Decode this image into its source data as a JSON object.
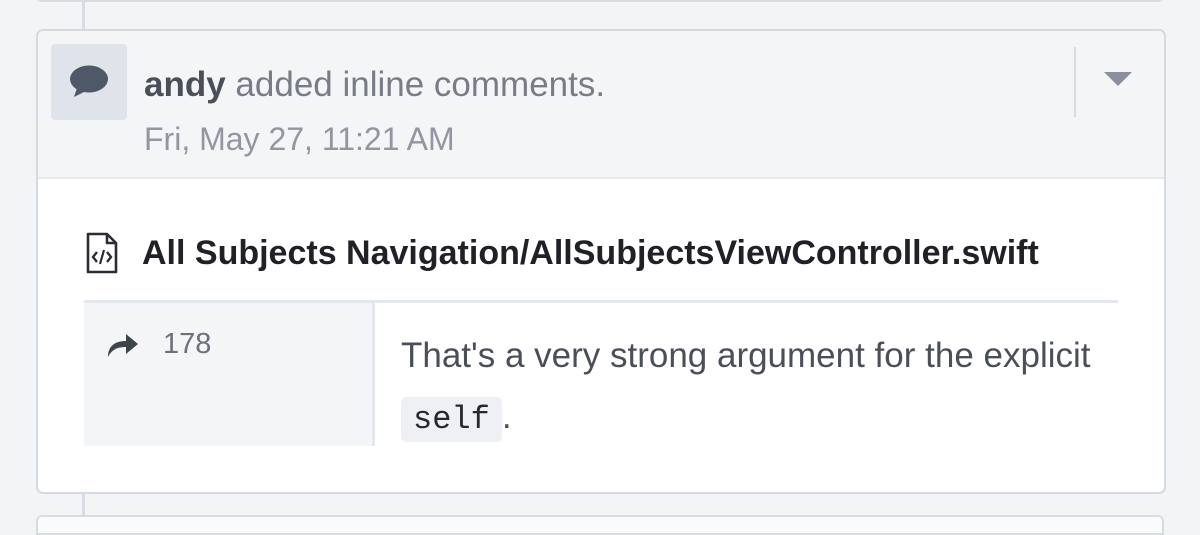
{
  "event": {
    "author": "andy",
    "action_text": " added inline comments.",
    "timestamp": "Fri, May 27, 11:21 AM",
    "avatar_icon": "comment-bubble-icon",
    "menu_icon": "caret-down-icon"
  },
  "file": {
    "icon": "code-file-icon",
    "path": "All Subjects Navigation/AllSubjectsViewController.swift"
  },
  "inline_comment": {
    "reply_icon": "reply-arrow-icon",
    "line_number": "178",
    "text_before_code": "That's a very strong argument for the explicit ",
    "code": "self",
    "text_after_code": "."
  },
  "colors": {
    "page_background": "#f3f4f6",
    "header_background": "#f4f5f7",
    "border": "#d5d9e0",
    "author_text": "#4b4f58",
    "muted_text": "#9196a0"
  }
}
